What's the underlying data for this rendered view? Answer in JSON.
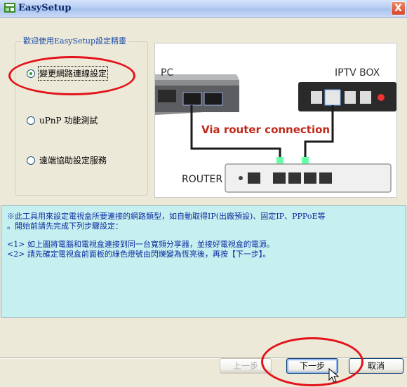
{
  "window": {
    "title": "EasySetup",
    "close_glyph": "X"
  },
  "group": {
    "label": "歡迎使用EasySetup設定精靈"
  },
  "options": [
    {
      "label": "變更網路連線設定",
      "checked": true
    },
    {
      "label": "uPnP 功能測試",
      "checked": false
    },
    {
      "label": "遠端協助設定服務",
      "checked": false
    }
  ],
  "diagram": {
    "pc_label": "PC",
    "iptv_label": "IPTV BOX",
    "connection_label": "Via router connection",
    "router_label": "ROUTER"
  },
  "info": {
    "line1": "※此工具用來設定電視盒所要連接的網路類型，如自動取得IP(出廠預設)、固定IP、PPPoE等",
    "line2": "。開始前請先完成下列步驟設定：",
    "step1": "<1> 如上圖將電腦和電視盒連接到同一台寬頻分享器，並接好電視盒的電源。",
    "step2": "<2> 請先確定電視盒前面板的綠色燈號由閃爍變為恆亮後，再按【下一步】。"
  },
  "buttons": {
    "back": "上一步",
    "next": "下一步",
    "cancel": "取消"
  },
  "colors": {
    "info_bg": "#c6f0f0",
    "info_text": "#0a2aa0",
    "highlight": "#e4121b",
    "connection_text": "#c0281a"
  },
  "icons": [
    "easysetup-app-icon",
    "close-icon",
    "mouse-cursor-icon"
  ]
}
